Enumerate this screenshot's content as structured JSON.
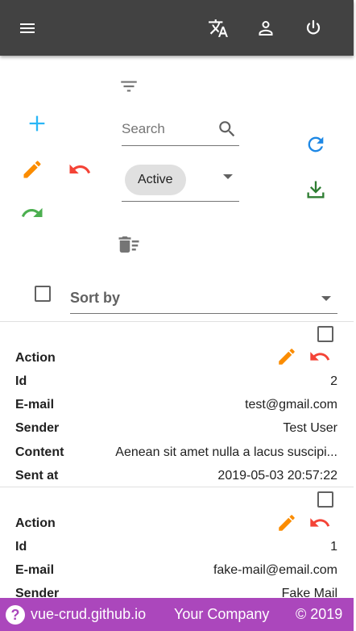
{
  "appbar": {
    "menu_icon": "menu-icon",
    "translate_icon": "translate-icon",
    "account_icon": "account-icon",
    "power_icon": "power-icon"
  },
  "toolbar": {
    "filter_icon": "filter-icon",
    "add_icon": "plus-icon",
    "edit_icon": "pencil-icon",
    "undo_icon": "undo-icon",
    "redo_icon": "redo-icon",
    "refresh_icon": "refresh-icon",
    "export_icon": "download-icon",
    "delete_icon": "delete-sweep-icon",
    "search_placeholder": "Search",
    "status_selected": "Active",
    "sort_label": "Sort by"
  },
  "records": [
    {
      "fields": [
        {
          "label": "Action",
          "value": ""
        },
        {
          "label": "Id",
          "value": "2"
        },
        {
          "label": "E-mail",
          "value": "test@gmail.com"
        },
        {
          "label": "Sender",
          "value": "Test User"
        },
        {
          "label": "Content",
          "value": "Aenean sit amet nulla a lacus suscipi..."
        },
        {
          "label": "Sent at",
          "value": "2019-05-03 20:57:22"
        }
      ]
    },
    {
      "fields": [
        {
          "label": "Action",
          "value": ""
        },
        {
          "label": "Id",
          "value": "1"
        },
        {
          "label": "E-mail",
          "value": "fake-mail@email.com"
        },
        {
          "label": "Sender",
          "value": "Fake Mail"
        }
      ]
    }
  ],
  "footer": {
    "help_icon": "help-circle-icon",
    "link": "vue-crud.github.io",
    "company": "Your Company",
    "copyright": "© 2019"
  },
  "colors": {
    "appbar": "#424242",
    "footer": "#ab47bc",
    "add": "#29b6f6",
    "edit": "#fb8c00",
    "undo": "#f44336",
    "redo": "#4caf50",
    "refresh": "#1e88e5",
    "export": "#2e7d32"
  }
}
